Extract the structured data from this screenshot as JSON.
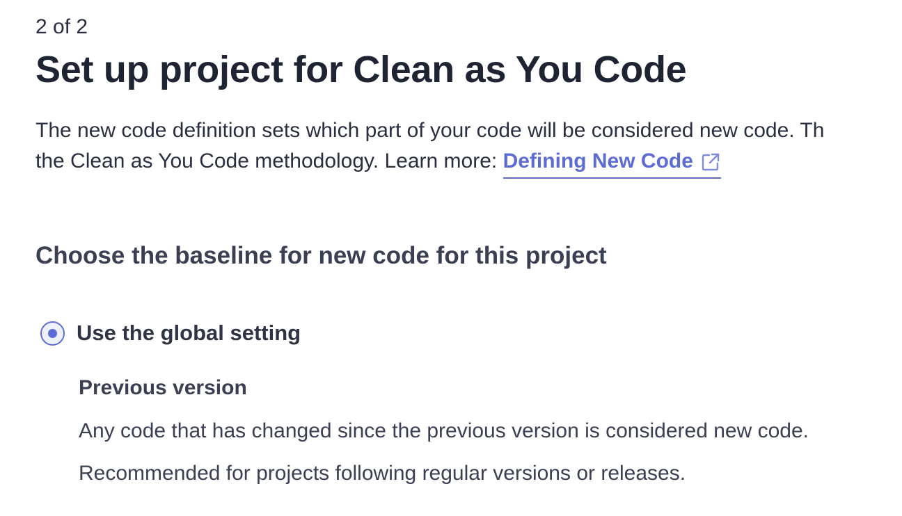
{
  "step": "2 of 2",
  "title": "Set up project for Clean as You Code",
  "description": {
    "line1": "The new code definition sets which part of your code will be considered new code. Th",
    "line2_prefix": "the Clean as You Code methodology. Learn more: ",
    "link_text": "Defining New Code",
    "link_icon": "external-link-icon"
  },
  "section_heading": "Choose the baseline for new code for this project",
  "option": {
    "label": "Use the global setting",
    "selected": true
  },
  "setting": {
    "name": "Previous version",
    "description_1": "Any code that has changed since the previous version is considered new code.",
    "description_2": "Recommended for projects following regular versions or releases."
  },
  "colors": {
    "accent": "#5d6cd0",
    "text": "#2a2f40"
  }
}
